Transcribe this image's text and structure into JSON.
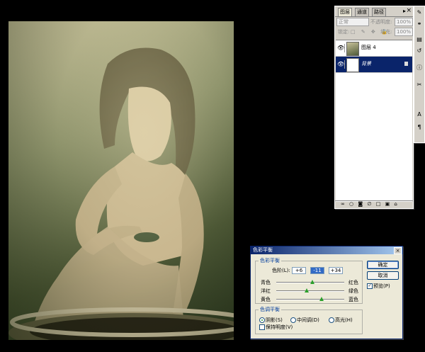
{
  "layers_panel": {
    "tabs": [
      "图层",
      "通道",
      "路径"
    ],
    "blend_mode": "正常",
    "opacity_label": "不透明度:",
    "opacity_value": "100%",
    "lock_label": "锁定:",
    "fill_label": "填充:",
    "fill_value": "100%",
    "layers": [
      {
        "name": "图层 4",
        "selected": false
      },
      {
        "name": "背景",
        "selected": true
      }
    ],
    "footer_icons": "∞ ○ ◙ ∅ □ ▣ ⌂"
  },
  "toolstrip": {
    "icons": [
      "brush-icon",
      "stamp-icon",
      "layers-icon",
      "history-icon",
      "info-icon",
      "tools-icon",
      "text-icon",
      "paragraph-icon"
    ],
    "glyphs": [
      "✎",
      "⚭",
      "▤",
      "↺",
      "ⓘ",
      "✂",
      "A",
      "¶"
    ]
  },
  "color_balance": {
    "title": "色彩平衡",
    "section_balance": "色彩平衡",
    "levels_label": "色阶(L):",
    "levels": [
      "+6",
      "-11",
      "+34"
    ],
    "sliders": [
      {
        "left": "青色",
        "right": "红色",
        "value": 6
      },
      {
        "left": "洋红",
        "right": "绿色",
        "value": -11
      },
      {
        "left": "黄色",
        "right": "蓝色",
        "value": 34
      }
    ],
    "section_tone": "色调平衡",
    "tone_options": [
      "阴影(S)",
      "中间调(D)",
      "高光(H)"
    ],
    "tone_selected": 0,
    "preserve_luminosity": "保持明度(V)",
    "ok": "确定",
    "cancel": "取消",
    "preview": "预览(P)",
    "preview_checked": true
  }
}
